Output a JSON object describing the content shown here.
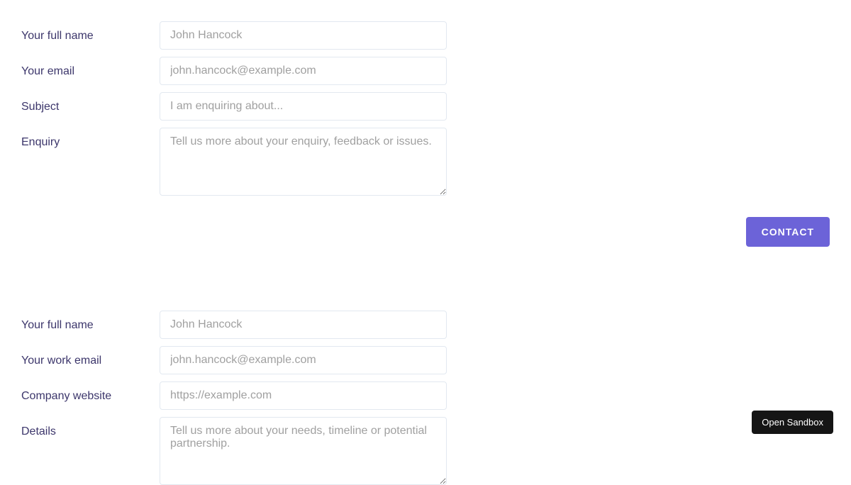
{
  "form1": {
    "fields": {
      "name": {
        "label": "Your full name",
        "placeholder": "John Hancock"
      },
      "email": {
        "label": "Your email",
        "placeholder": "john.hancock@example.com"
      },
      "subject": {
        "label": "Subject",
        "placeholder": "I am enquiring about..."
      },
      "enquiry": {
        "label": "Enquiry",
        "placeholder": "Tell us more about your enquiry, feedback or issues."
      }
    },
    "button": "CONTACT"
  },
  "form2": {
    "fields": {
      "name": {
        "label": "Your full name",
        "placeholder": "John Hancock"
      },
      "email": {
        "label": "Your work email",
        "placeholder": "john.hancock@example.com"
      },
      "website": {
        "label": "Company website",
        "placeholder": "https://example.com"
      },
      "details": {
        "label": "Details",
        "placeholder": "Tell us more about your needs, timeline or potential partnership."
      }
    }
  },
  "sandbox_button": "Open Sandbox"
}
